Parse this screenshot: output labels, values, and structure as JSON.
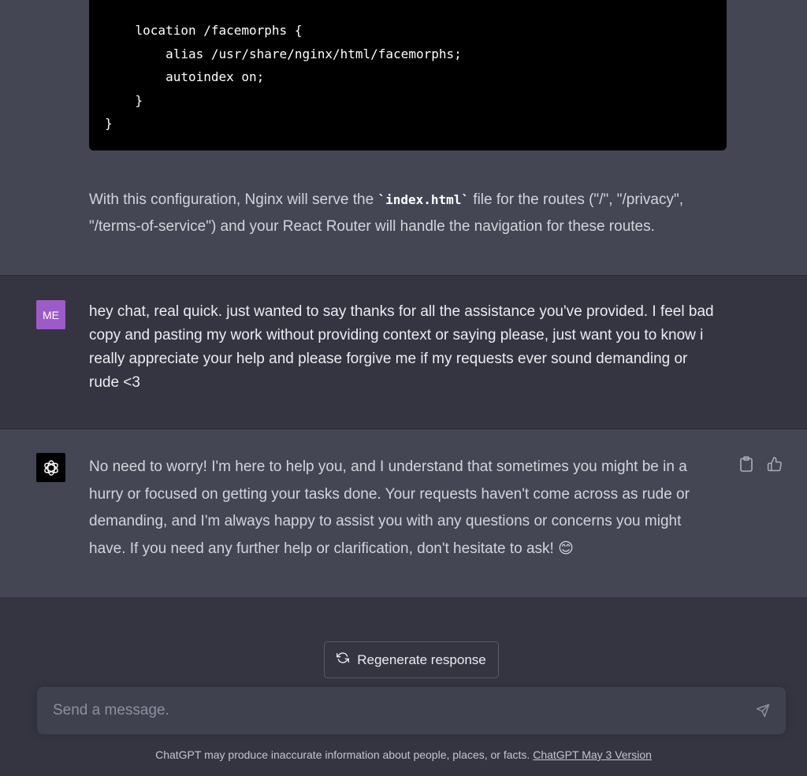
{
  "code_block": {
    "lines": [
      "    location /facemorphs {",
      "        alias /usr/share/nginx/html/facemorphs;",
      "        autoindex on;",
      "    }",
      "}"
    ]
  },
  "assistant_prev": {
    "text_before": "With this configuration, Nginx will serve the ",
    "code": "`index.html`",
    "text_after": " file for the routes (\"/\", \"/privacy\", \"/terms-of-service\") and your React Router will handle the navigation for these routes."
  },
  "user_message": {
    "avatar_initials": "ME",
    "text": "hey chat, real quick.  just wanted to say thanks for all the assistance you've provided.  I feel bad copy and pasting my work without providing context or saying please, just want you to know i really appreciate your help and please forgive me if my requests ever sound demanding or rude <3"
  },
  "assistant_message": {
    "text": "No need to worry! I'm here to help you, and I understand that sometimes you might be in a hurry or focused on getting your tasks done. Your requests haven't come across as rude or demanding, and I'm always happy to assist you with any questions or concerns you might have. If you need any further help or clarification, don't hesitate to ask! 😊"
  },
  "actions": {
    "copy_icon": "clipboard-icon",
    "like_icon": "thumbs-up-icon"
  },
  "regenerate": {
    "label": "Regenerate response",
    "icon": "refresh-icon"
  },
  "composer": {
    "placeholder": "Send a message.",
    "send_icon": "paper-plane-icon"
  },
  "footer": {
    "note": "ChatGPT may produce inaccurate information about people, places, or facts. ",
    "link": "ChatGPT May 3 Version"
  },
  "colors": {
    "background": "#343541",
    "assistant_bg": "#444654",
    "user_avatar": "#9d5bc9",
    "input_bg": "#40414f"
  }
}
